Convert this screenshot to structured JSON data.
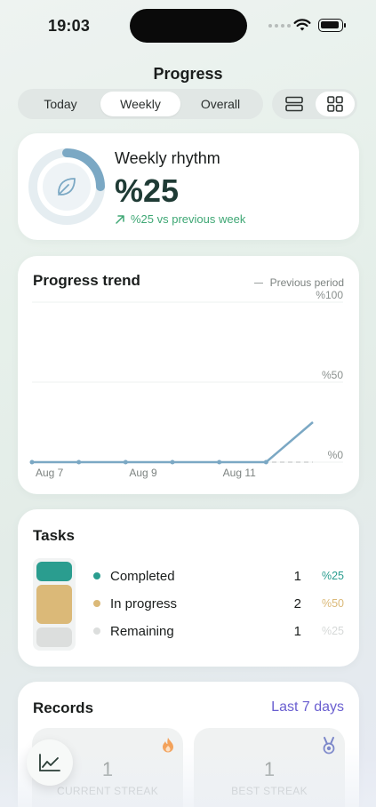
{
  "status_bar": {
    "time": "19:03"
  },
  "header": {
    "title": "Progress"
  },
  "period_tabs": [
    {
      "label": "Today",
      "active": false
    },
    {
      "label": "Weekly",
      "active": true
    },
    {
      "label": "Overall",
      "active": false
    }
  ],
  "view_toggle": [
    {
      "icon": "list-layout-icon",
      "active": false
    },
    {
      "icon": "grid-layout-icon",
      "active": true
    }
  ],
  "rhythm": {
    "title": "Weekly rhythm",
    "value": "%25",
    "progress": 0.25,
    "delta": "%25 vs previous week",
    "icon": "leaf-icon",
    "ring_color": "#7ba8c4",
    "delta_color": "#3ea774"
  },
  "trend": {
    "title": "Progress trend",
    "legend_previous": "Previous period",
    "y_ticks": [
      "%100",
      "%50",
      "%0"
    ],
    "x_ticks": [
      "Aug 7",
      "Aug 9",
      "Aug 11"
    ],
    "line_color": "#7ba8c4"
  },
  "chart_data": {
    "type": "line",
    "title": "Progress trend",
    "x": [
      "Aug 7",
      "Aug 8",
      "Aug 9",
      "Aug 10",
      "Aug 11",
      "Aug 12",
      "Aug 13"
    ],
    "series": [
      {
        "values": [
          0,
          0,
          0,
          0,
          0,
          0,
          25
        ]
      },
      {
        "name": "Previous period",
        "values": [
          0,
          0,
          0,
          0,
          0,
          0,
          0
        ]
      }
    ],
    "ylim": [
      0,
      100
    ],
    "grid": true,
    "legend": "top-right"
  },
  "tasks": {
    "title": "Tasks",
    "items": [
      {
        "label": "Completed",
        "count": "1",
        "pct": "%25",
        "color": "#2a9d8f",
        "fraction": 0.25
      },
      {
        "label": "In progress",
        "count": "2",
        "pct": "%50",
        "color": "#dbb978",
        "fraction": 0.5
      },
      {
        "label": "Remaining",
        "count": "1",
        "pct": "%25",
        "color": "#dcdedd",
        "fraction": 0.25
      }
    ]
  },
  "records": {
    "title": "Records",
    "range": "Last 7 days",
    "tiles": [
      {
        "value": "1",
        "label": "CURRENT STREAK",
        "icon": "flame-icon"
      },
      {
        "value": "1",
        "label": "BEST STREAK",
        "icon": "medal-icon"
      }
    ]
  },
  "fab": {
    "icon": "chart-line-icon"
  }
}
